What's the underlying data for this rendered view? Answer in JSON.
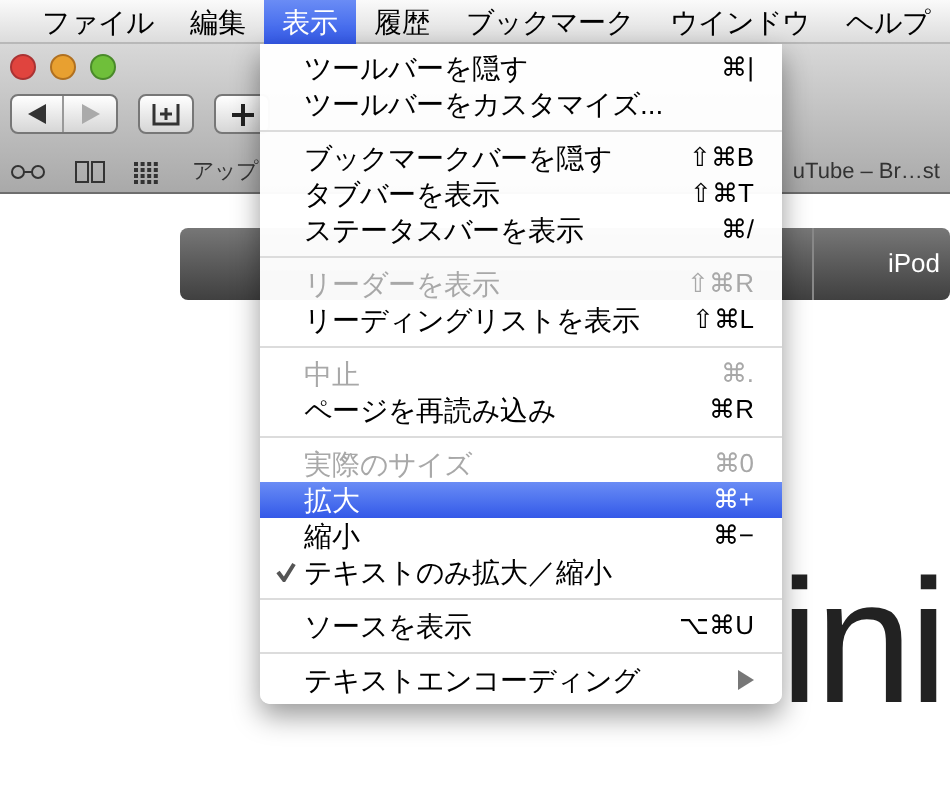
{
  "menu_bar": [
    {
      "label": "ファイル",
      "selected": false
    },
    {
      "label": "編集",
      "selected": false
    },
    {
      "label": "表示",
      "selected": true
    },
    {
      "label": "履歴",
      "selected": false
    },
    {
      "label": "ブックマーク",
      "selected": false
    },
    {
      "label": "ウインドウ",
      "selected": false
    },
    {
      "label": "ヘルプ",
      "selected": false
    }
  ],
  "bookmarks_bar": {
    "left_item": "アップ",
    "right_item": "uTube – Br…st"
  },
  "page": {
    "nav_item": "iPod",
    "heading": "ini"
  },
  "menu": [
    {
      "kind": "item",
      "label": "ツールバーを隠す",
      "shortcut": "⌘|",
      "disabled": false,
      "selected": false,
      "checked": false
    },
    {
      "kind": "item",
      "label": "ツールバーをカスタマイズ...",
      "disabled": false,
      "selected": false,
      "checked": false
    },
    {
      "kind": "separator"
    },
    {
      "kind": "item",
      "label": "ブックマークバーを隠す",
      "shortcut": "⇧⌘B",
      "disabled": false,
      "selected": false,
      "checked": false
    },
    {
      "kind": "item",
      "label": "タブバーを表示",
      "shortcut": "⇧⌘T",
      "disabled": false,
      "selected": false,
      "checked": false
    },
    {
      "kind": "item",
      "label": "ステータスバーを表示",
      "shortcut": "⌘/",
      "disabled": false,
      "selected": false,
      "checked": false
    },
    {
      "kind": "separator"
    },
    {
      "kind": "item",
      "label": "リーダーを表示",
      "shortcut": "⇧⌘R",
      "disabled": true,
      "selected": false,
      "checked": false
    },
    {
      "kind": "item",
      "label": "リーディングリストを表示",
      "shortcut": "⇧⌘L",
      "disabled": false,
      "selected": false,
      "checked": false
    },
    {
      "kind": "separator"
    },
    {
      "kind": "item",
      "label": "中止",
      "shortcut": "⌘.",
      "disabled": true,
      "selected": false,
      "checked": false
    },
    {
      "kind": "item",
      "label": "ページを再読み込み",
      "shortcut": "⌘R",
      "disabled": false,
      "selected": false,
      "checked": false
    },
    {
      "kind": "separator"
    },
    {
      "kind": "item",
      "label": "実際のサイズ",
      "shortcut": "⌘0",
      "disabled": true,
      "selected": false,
      "checked": false
    },
    {
      "kind": "item",
      "label": "拡大",
      "shortcut": "⌘+",
      "disabled": false,
      "selected": true,
      "checked": false
    },
    {
      "kind": "item",
      "label": "縮小",
      "shortcut": "⌘−",
      "disabled": false,
      "selected": false,
      "checked": false
    },
    {
      "kind": "item",
      "label": "テキストのみ拡大／縮小",
      "disabled": false,
      "selected": false,
      "checked": true
    },
    {
      "kind": "separator"
    },
    {
      "kind": "item",
      "label": "ソースを表示",
      "shortcut": "⌥⌘U",
      "disabled": false,
      "selected": false,
      "checked": false
    },
    {
      "kind": "separator"
    },
    {
      "kind": "item",
      "label": "テキストエンコーディング",
      "submenu": true,
      "disabled": false,
      "selected": false,
      "checked": false
    }
  ]
}
